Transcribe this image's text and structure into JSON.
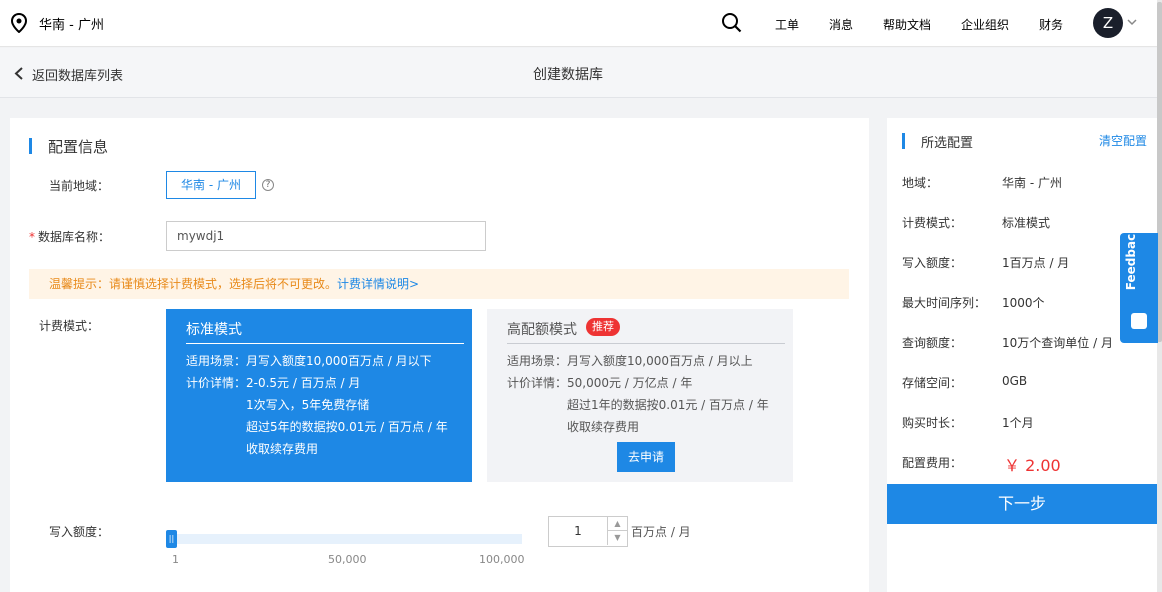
{
  "topbar": {
    "region": "华南 - 广州",
    "nav": [
      "工单",
      "消息",
      "帮助文档",
      "企业组织",
      "财务"
    ],
    "avatar_letter": "Z"
  },
  "subheader": {
    "back_label": "返回数据库列表",
    "title": "创建数据库"
  },
  "config": {
    "section_title": "配置信息",
    "region_label": "当前地域：",
    "region_value": "华南 - 广州",
    "help_glyph": "?",
    "name_label": "数据库名称：",
    "name_value": "mywdj1",
    "tip_text": "温馨提示：请谨慎选择计费模式，选择后将不可更改。",
    "tip_link": "计费详情说明>",
    "billing_label": "计费模式：",
    "write_quota_label": "写入额度："
  },
  "plans": [
    {
      "title": "标准模式",
      "scene": "适用场景：月写入额度10,000百万点 / 月以下",
      "price_label": "计价详情：",
      "price_lines": [
        "2-0.5元 / 百万点 / 月",
        "1次写入，5年免费存储",
        "超过5年的数据按0.01元 / 百万点 / 年",
        "收取续存费用"
      ]
    },
    {
      "title": "高配额模式",
      "badge": "推荐",
      "scene": "适用场景：月写入额度10,000百万点 / 月以上",
      "price_label": "计价详情：",
      "price_lines": [
        "50,000元 / 万亿点 / 年",
        "超过1年的数据按0.01元 / 百万点 / 年",
        "收取续存费用"
      ],
      "apply_label": "去申请"
    }
  ],
  "slider": {
    "min_label": "1",
    "mid_label": "50,000",
    "max_label": "100,000",
    "value": "1",
    "unit": "百万点 / 月"
  },
  "summary": {
    "title": "所选配置",
    "clear_label": "清空配置",
    "rows": [
      {
        "label": "地域：",
        "value": "华南 - 广州"
      },
      {
        "label": "计费模式：",
        "value": "标准模式"
      },
      {
        "label": "写入额度：",
        "value": "1百万点 / 月"
      },
      {
        "label": "最大时间序列：",
        "value": "1000个"
      },
      {
        "label": "查询额度：",
        "value": "10万个查询单位 / 月"
      },
      {
        "label": "存储空间：",
        "value": "0GB"
      },
      {
        "label": "购买时长：",
        "value": "1个月"
      }
    ],
    "fee_label": "配置费用：",
    "fee_value": "￥ 2.00",
    "next_label": "下一步"
  },
  "feedback_label": "Feedback",
  "colors": {
    "accent": "#1e88e5",
    "price": "#e33333",
    "tip": "#e88a1a"
  }
}
